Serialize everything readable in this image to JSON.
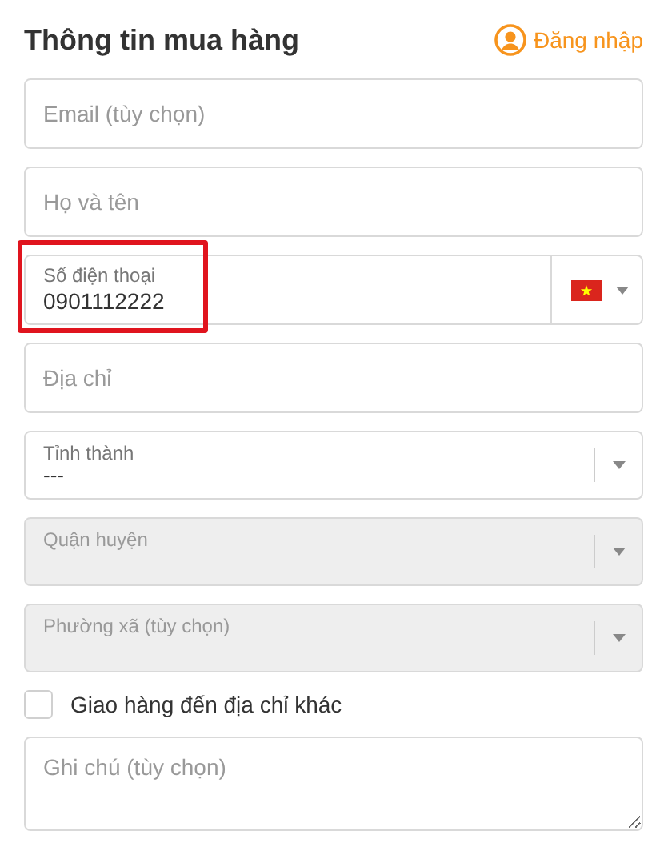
{
  "header": {
    "title": "Thông tin mua hàng",
    "login_link": "Đăng nhập"
  },
  "fields": [
    {
      "kind": "text",
      "placeholder": "Email (tùy chọn)"
    },
    {
      "kind": "text",
      "placeholder": "Họ và tên"
    },
    {
      "kind": "phone",
      "label": "Số điện thoại",
      "value": "0901112222",
      "highlighted": true
    },
    {
      "kind": "text",
      "placeholder": "Địa chỉ"
    },
    {
      "kind": "select",
      "label": "Tỉnh thành",
      "value": "---",
      "disabled": false
    },
    {
      "kind": "select",
      "label": "Quận huyện",
      "disabled": true
    },
    {
      "kind": "select",
      "label": "Phường xã (tùy chọn)",
      "disabled": true
    },
    {
      "kind": "checkbox",
      "label": "Giao hàng đến địa chỉ khác",
      "checked": false
    },
    {
      "kind": "textarea",
      "placeholder": "Ghi chú (tùy chọn)"
    }
  ]
}
